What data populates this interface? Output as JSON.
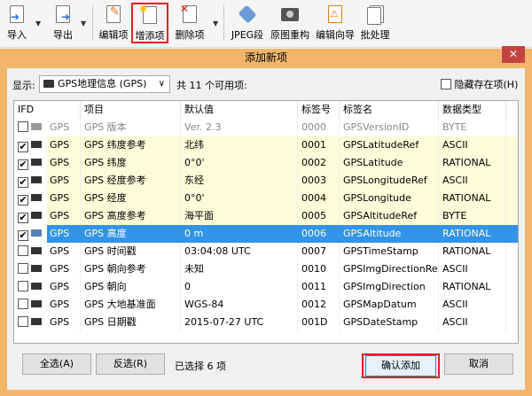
{
  "toolbar": {
    "items": [
      {
        "label": "导入",
        "icon": "import-icon"
      },
      {
        "label": "导出",
        "icon": "export-icon"
      },
      {
        "label": "编辑项",
        "icon": "edit-item-icon"
      },
      {
        "label": "增添项",
        "icon": "add-item-icon"
      },
      {
        "label": "删除项",
        "icon": "delete-item-icon"
      },
      {
        "label": "JPEG段",
        "icon": "tag-icon"
      },
      {
        "label": "原图重构",
        "icon": "camera-icon"
      },
      {
        "label": "编辑向导",
        "icon": "wizard-icon"
      },
      {
        "label": "批处理",
        "icon": "batch-icon"
      }
    ]
  },
  "dialog": {
    "title": "添加新项",
    "close": "✕",
    "show_label": "显示:",
    "show_value": "GPS地理信息 (GPS)",
    "available": "共 11 个可用项:",
    "hide_existing": "隐藏存在项(H)",
    "columns": [
      "IFD",
      "项目",
      "默认值",
      "标签号",
      "标签名",
      "数据类型"
    ],
    "rows": [
      {
        "checked": false,
        "type": "int",
        "ifd": "GPS",
        "item": "GPS 版本",
        "default": "Ver. 2.3",
        "tag": "0000",
        "name": "GPSVersionID",
        "dtype": "BYTE",
        "state": "disabled"
      },
      {
        "checked": true,
        "type": "ABC",
        "ifd": "GPS",
        "item": "GPS 纬度参考",
        "default": "北纬",
        "tag": "0001",
        "name": "GPSLatitudeRef",
        "dtype": "ASCII",
        "state": "highlight"
      },
      {
        "checked": true,
        "type": "rat",
        "ifd": "GPS",
        "item": "GPS 纬度",
        "default": "0°0'",
        "tag": "0002",
        "name": "GPSLatitude",
        "dtype": "RATIONAL",
        "state": "highlight"
      },
      {
        "checked": true,
        "type": "ABC",
        "ifd": "GPS",
        "item": "GPS 经度参考",
        "default": "东经",
        "tag": "0003",
        "name": "GPSLongitudeRef",
        "dtype": "ASCII",
        "state": "highlight"
      },
      {
        "checked": true,
        "type": "rat",
        "ifd": "GPS",
        "item": "GPS 经度",
        "default": "0°0'",
        "tag": "0004",
        "name": "GPSLongitude",
        "dtype": "RATIONAL",
        "state": "highlight"
      },
      {
        "checked": true,
        "type": "int",
        "ifd": "GPS",
        "item": "GPS 高度参考",
        "default": "海平面",
        "tag": "0005",
        "name": "GPSAltitudeRef",
        "dtype": "BYTE",
        "state": "highlight"
      },
      {
        "checked": true,
        "type": "rat",
        "ifd": "GPS",
        "item": "GPS 高度",
        "default": "0 m",
        "tag": "0006",
        "name": "GPSAltitude",
        "dtype": "RATIONAL",
        "state": "selected"
      },
      {
        "checked": false,
        "type": "rat",
        "ifd": "GPS",
        "item": "GPS 时间戳",
        "default": "03:04:08 UTC",
        "tag": "0007",
        "name": "GPSTimeStamp",
        "dtype": "RATIONAL",
        "state": "normal"
      },
      {
        "checked": false,
        "type": "ABC",
        "ifd": "GPS",
        "item": "GPS 朝向参考",
        "default": "未知",
        "tag": "0010",
        "name": "GPSImgDirectionRef",
        "dtype": "ASCII",
        "state": "normal"
      },
      {
        "checked": false,
        "type": "rat",
        "ifd": "GPS",
        "item": "GPS 朝向",
        "default": "0",
        "tag": "0011",
        "name": "GPSImgDirection",
        "dtype": "RATIONAL",
        "state": "normal"
      },
      {
        "checked": false,
        "type": "ABC",
        "ifd": "GPS",
        "item": "GPS 大地基准面",
        "default": "WGS-84",
        "tag": "0012",
        "name": "GPSMapDatum",
        "dtype": "ASCII",
        "state": "normal"
      },
      {
        "checked": false,
        "type": "ABC",
        "ifd": "GPS",
        "item": "GPS 日期戳",
        "default": "2015-07-27 UTC",
        "tag": "001D",
        "name": "GPSDateStamp",
        "dtype": "ASCII",
        "state": "normal"
      }
    ],
    "select_all": "全选(A)",
    "invert": "反选(R)",
    "selected_count": "已选择 6 项",
    "confirm": "确认添加",
    "cancel": "取消"
  },
  "colors": {
    "highlight": "#fefcd8",
    "selected": "#3393e6",
    "frame": "#f2b66a",
    "annotation": "#e32020"
  }
}
